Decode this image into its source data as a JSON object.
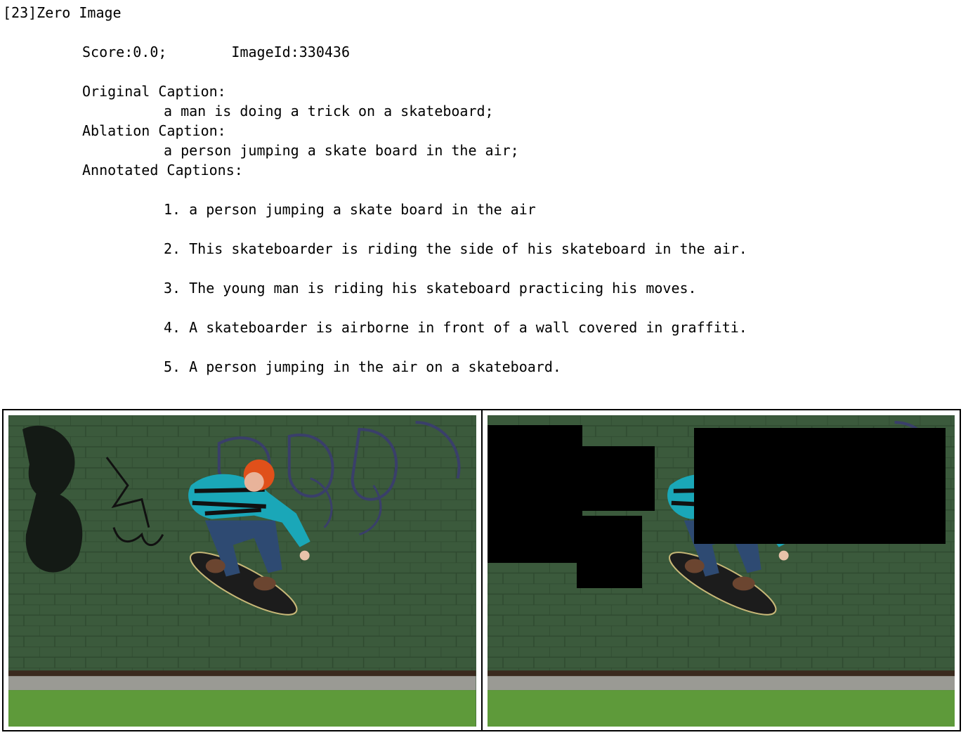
{
  "header": {
    "title": "[23]Zero Image"
  },
  "meta": {
    "score": "Score:0.0;",
    "image_id": "ImageId:330436"
  },
  "original": {
    "label": "Original Caption:",
    "text": "a man is doing a trick on a skateboard;"
  },
  "ablation": {
    "label": "Ablation Caption:",
    "text": "a person jumping a skate board in the air;"
  },
  "annotated": {
    "label": "Annotated Captions:",
    "items": [
      "1. a person jumping a skate board in the air",
      "2. This skateboarder is riding the side of his skateboard in the air.",
      "3. The young man is riding his skateboard practicing his moves.",
      "4. A skateboarder is airborne in front of a wall covered in graffiti.",
      "5. A person jumping in the air on a skateboard."
    ]
  },
  "images": {
    "original": {
      "name": "original-photo"
    },
    "ablated": {
      "name": "ablated-photo",
      "mask_color": "#000000"
    }
  },
  "colors": {
    "wall": "#3b5a3c",
    "grass": "#5e9a3a",
    "path": "#9a9a94",
    "shirt": "#1aa7b8",
    "hair": "#e0501a"
  }
}
